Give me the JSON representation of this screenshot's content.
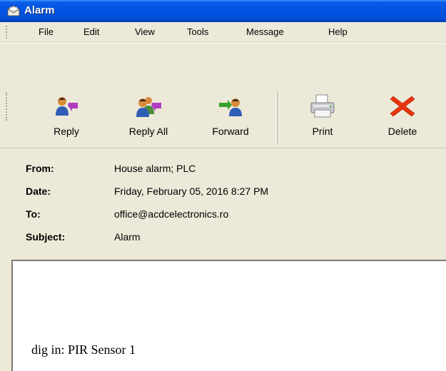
{
  "window": {
    "title": "Alarm",
    "title_icon": "envelope-icon"
  },
  "menu": [
    "File",
    "Edit",
    "View",
    "Tools",
    "Message",
    "Help"
  ],
  "toolbar": {
    "reply": {
      "label": "Reply",
      "icon": "reply-icon"
    },
    "reply_all": {
      "label": "Reply All",
      "icon": "reply-all-icon"
    },
    "forward": {
      "label": "Forward",
      "icon": "forward-icon"
    },
    "print": {
      "label": "Print",
      "icon": "printer-icon"
    },
    "delete": {
      "label": "Delete",
      "icon": "delete-x-icon"
    }
  },
  "header": {
    "from": {
      "label": "From:",
      "value": "House alarm; PLC"
    },
    "date": {
      "label": "Date:",
      "value": "Friday, February 05, 2016 8:27 PM"
    },
    "to": {
      "label": "To:",
      "value": "office@acdcelectronics.ro"
    },
    "subject": {
      "label": "Subject:",
      "value": "Alarm"
    }
  },
  "body": {
    "text": "dig in: PIR Sensor 1"
  },
  "colors": {
    "titlebar": "#0054e3",
    "chrome": "#ece9d8",
    "delete_red": "#e8340c"
  }
}
